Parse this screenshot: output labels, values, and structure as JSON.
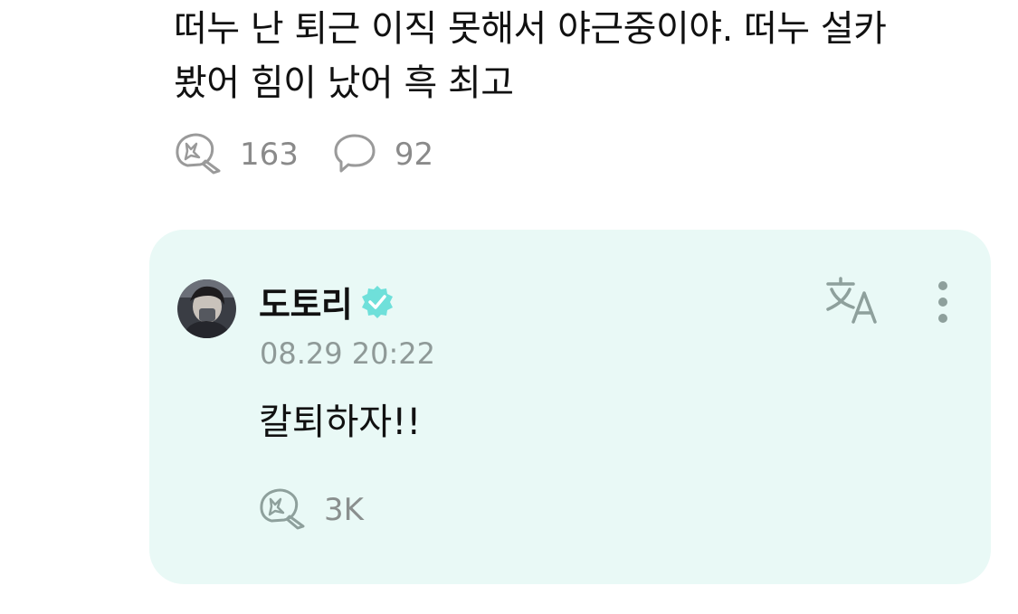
{
  "post": {
    "text_line1": "떠누 난 퇴근 이직 못해서 야근중이야. 떠누 설카",
    "text_line2": "봤어 힘이 났어 흑 최고",
    "like_count": "163",
    "comment_count": "92",
    "icons": {
      "like": "like-bubble-icon",
      "comment": "comment-bubble-icon"
    }
  },
  "reply": {
    "author": "도토리",
    "timestamp": "08.29 20:22",
    "text": "칼퇴하자!!",
    "like_count": "3K",
    "icons": {
      "verified": "verified-badge-icon",
      "translate": "translate-icon",
      "more": "more-vertical-icon",
      "like": "like-bubble-icon"
    }
  },
  "colors": {
    "card_background": "#e9f9f6",
    "verified_badge": "#6fe0da",
    "muted_text": "#8a8a8a",
    "primary_text": "#111111"
  }
}
